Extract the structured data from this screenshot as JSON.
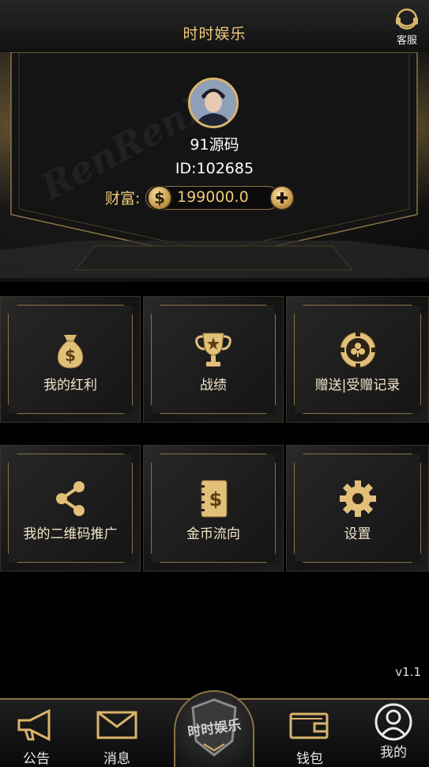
{
  "header": {
    "title": "时时娱乐",
    "service_label": "客服"
  },
  "profile": {
    "watermark": "RenRenPo",
    "name": "91源码",
    "id_text": "ID:102685",
    "wealth_label": "财富:",
    "wealth_value": "199000.0",
    "coin_symbol": "$"
  },
  "menu": [
    {
      "label": "我的红利",
      "icon": "money-bag-icon"
    },
    {
      "label": "战绩",
      "icon": "trophy-icon"
    },
    {
      "label": "赠送|受赠记录",
      "icon": "poker-chip-icon"
    },
    {
      "label": "我的二维码推广",
      "icon": "share-icon"
    },
    {
      "label": "金币流向",
      "icon": "notebook-coin-icon"
    },
    {
      "label": "设置",
      "icon": "gear-icon"
    }
  ],
  "version": "v1.1",
  "bottom_nav": {
    "items": [
      {
        "label": "公告",
        "icon": "megaphone-icon"
      },
      {
        "label": "消息",
        "icon": "envelope-icon"
      },
      {
        "label": "钱包",
        "icon": "wallet-icon"
      },
      {
        "label": "我的",
        "icon": "user-icon"
      }
    ],
    "center_logo": "时时娱乐"
  },
  "colors": {
    "gold": "#f0c97a",
    "frame": "#8a7346",
    "background": "#000000"
  }
}
